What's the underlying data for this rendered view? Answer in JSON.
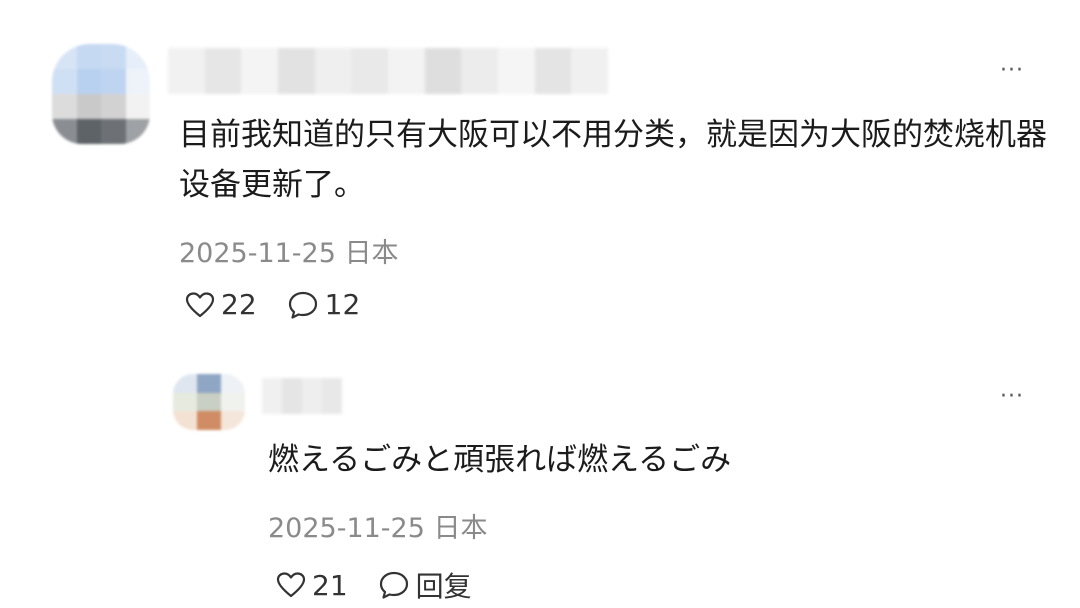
{
  "comment": {
    "text": "目前我知道的只有大阪可以不用分类，就是因为大阪的焚烧机器设备更新了。",
    "date": "2025-11-25",
    "location": "日本",
    "likes": "22",
    "replies": "12",
    "more_label": "···"
  },
  "reply": {
    "text": "燃えるごみと頑張れば燃えるごみ",
    "date": "2025-11-25",
    "location": "日本",
    "likes": "21",
    "reply_label": "回复",
    "more_label": "···"
  },
  "icons": {
    "like": "heart-outline-icon",
    "comment": "speech-bubble-outline-icon",
    "more": "ellipsis-icon"
  },
  "colors": {
    "meta_text": "#8a8a8a",
    "primary_text": "#1b1b1b"
  }
}
